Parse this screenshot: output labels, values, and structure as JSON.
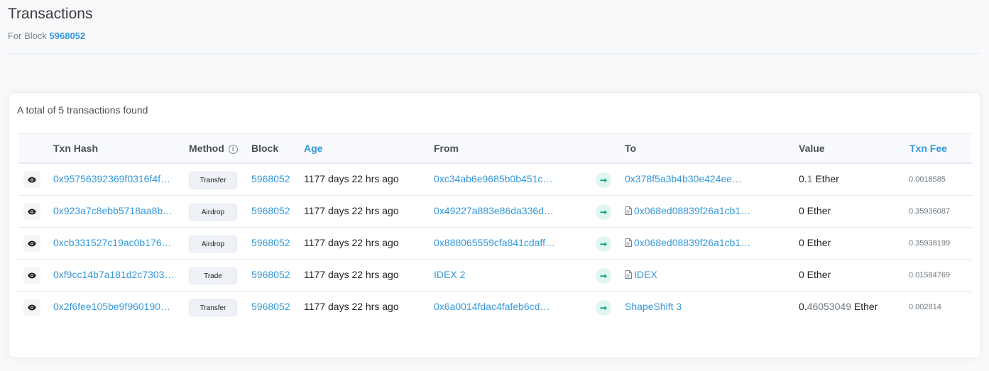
{
  "header": {
    "title": "Transactions",
    "subtitle_prefix": "For Block",
    "block": "5968052"
  },
  "card": {
    "summary": "A total of 5 transactions found"
  },
  "columns": {
    "txn_hash": "Txn Hash",
    "method": "Method",
    "block": "Block",
    "age": "Age",
    "from": "From",
    "to": "To",
    "value": "Value",
    "txn_fee": "Txn Fee"
  },
  "rows": [
    {
      "hash": "0x95756392369f0316f4f…",
      "method": "Transfer",
      "block": "5968052",
      "age": "1177 days 22 hrs ago",
      "from": "0xc34ab6e9685b0b451c…",
      "to": "0x378f5a3b4b30e424ee…",
      "to_is_contract": false,
      "value_main": "0.",
      "value_faint": "1",
      "value_unit": " Ether",
      "fee": "0.0018585"
    },
    {
      "hash": "0x923a7c8ebb5718aa8b…",
      "method": "Airdrop",
      "block": "5968052",
      "age": "1177 days 22 hrs ago",
      "from": "0x49227a883e86da336d…",
      "to": "0x068ed08839f26a1cb1…",
      "to_is_contract": true,
      "value_main": "0",
      "value_faint": "",
      "value_unit": " Ether",
      "fee": "0.35936087"
    },
    {
      "hash": "0xcb331527c19ac0b176…",
      "method": "Airdrop",
      "block": "5968052",
      "age": "1177 days 22 hrs ago",
      "from": "0x888065559cfa841cdaff…",
      "to": "0x068ed08839f26a1cb1…",
      "to_is_contract": true,
      "value_main": "0",
      "value_faint": "",
      "value_unit": " Ether",
      "fee": "0.35938199"
    },
    {
      "hash": "0xf9cc14b7a181d2c7303…",
      "method": "Trade",
      "block": "5968052",
      "age": "1177 days 22 hrs ago",
      "from": "IDEX 2",
      "to": "IDEX",
      "to_is_contract": true,
      "value_main": "0",
      "value_faint": "",
      "value_unit": " Ether",
      "fee": "0.01584769"
    },
    {
      "hash": "0x2f6fee105be9f960190…",
      "method": "Transfer",
      "block": "5968052",
      "age": "1177 days 22 hrs ago",
      "from": "0x6a0014fdac4fafeb6cd…",
      "to": "ShapeShift 3",
      "to_is_contract": false,
      "value_main": "0.",
      "value_faint": "46053049",
      "value_unit": " Ether",
      "fee": "0.002814"
    }
  ],
  "icons": {
    "view": "eye-icon",
    "method_info": "info-icon",
    "direction": "arrow-right-icon",
    "contract": "document-icon"
  },
  "colors": {
    "link": "#3498db",
    "arrow_bg": "#def7ef",
    "arrow_fg": "#00a186"
  }
}
